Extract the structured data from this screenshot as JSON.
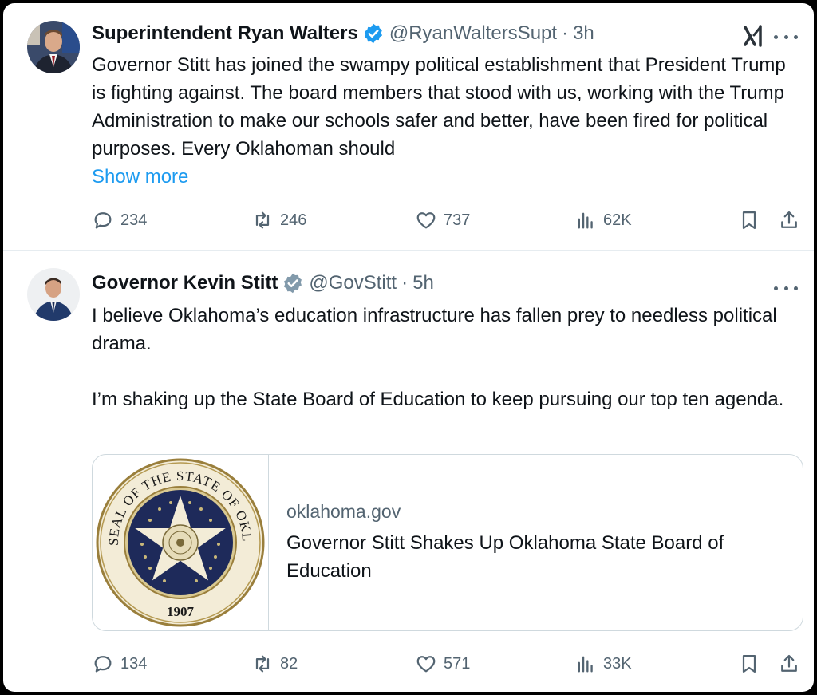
{
  "tweets": [
    {
      "author_name": "Superintendent Ryan Walters",
      "handle": "@RyanWaltersSupt",
      "separator": "·",
      "time": "3h",
      "text": "Governor Stitt has joined the swampy political establishment that President Trump is fighting against. The board members that stood with us, working with the Trump Administration to make our schools safer and better, have been fired for political purposes. Every Oklahoman should",
      "show_more": "Show more",
      "replies": "234",
      "reposts": "246",
      "likes": "737",
      "views": "62K",
      "badge_color": "#1d9bf0"
    },
    {
      "author_name": "Governor Kevin Stitt",
      "handle": "@GovStitt",
      "separator": "·",
      "time": "5h",
      "paragraph1": "I believe Oklahoma’s education infrastructure has fallen prey to needless political drama.",
      "paragraph2": "I’m shaking up the State Board of Education to keep pursuing our top ten agenda.",
      "card": {
        "domain": "oklahoma.gov",
        "title": "Governor Stitt Shakes Up Oklahoma State Board of Education",
        "seal_top_text": "GREAT SEAL OF THE STATE OF OKLAHOMA",
        "seal_year": "1907"
      },
      "replies": "134",
      "reposts": "82",
      "likes": "571",
      "views": "33K",
      "badge_color": "#829aab"
    }
  ],
  "icons": [
    "grok-icon",
    "more-icon",
    "reply-icon",
    "repost-icon",
    "like-icon",
    "views-icon",
    "bookmark-icon",
    "share-icon",
    "verified-badge-icon"
  ]
}
